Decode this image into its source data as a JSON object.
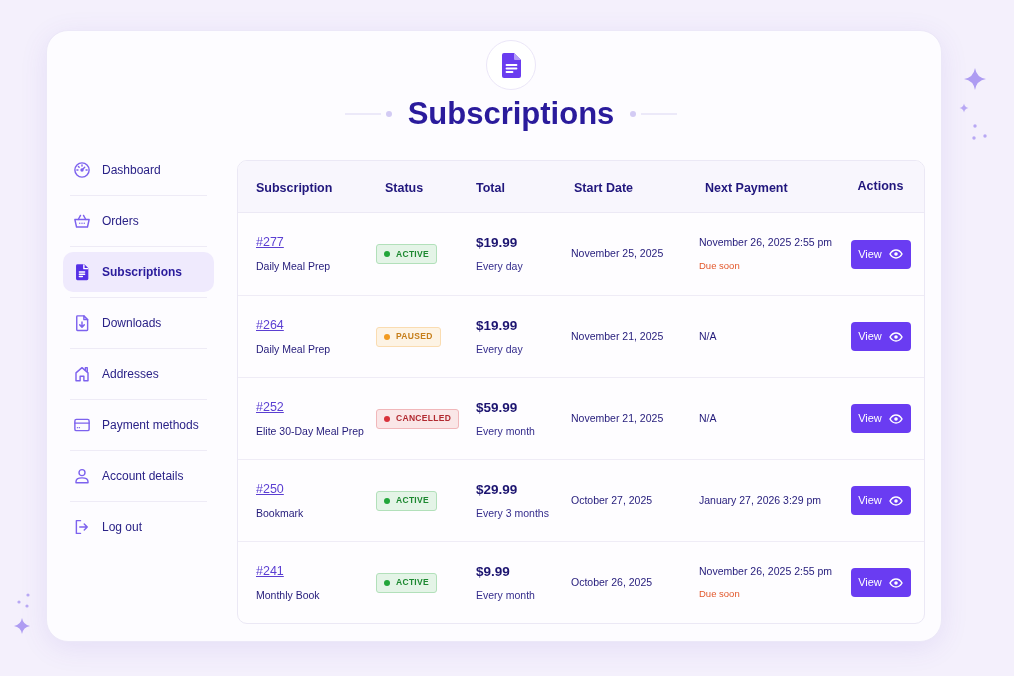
{
  "header": {
    "title": "Subscriptions"
  },
  "sidebar": {
    "items": [
      {
        "label": "Dashboard",
        "selected": false
      },
      {
        "label": "Orders",
        "selected": false
      },
      {
        "label": "Subscriptions",
        "selected": true
      },
      {
        "label": "Downloads",
        "selected": false
      },
      {
        "label": "Addresses",
        "selected": false
      },
      {
        "label": "Payment methods",
        "selected": false
      },
      {
        "label": "Account details",
        "selected": false
      },
      {
        "label": "Log out",
        "selected": false
      }
    ]
  },
  "table": {
    "columns": [
      "Subscription",
      "Status",
      "Total",
      "Start Date",
      "Next Payment",
      "Actions"
    ],
    "rows": [
      {
        "number": "#277",
        "product": "Daily Meal Prep",
        "status": {
          "label": "ACTIVE",
          "color": "#22a63a"
        },
        "total": "$19.99",
        "interval": "Every day",
        "start_date": "November 25, 2025",
        "next_payment": "November 26, 2025 2:55 pm",
        "note": "Due soon",
        "action": "View"
      },
      {
        "number": "#264",
        "product": "Daily Meal Prep",
        "status": {
          "label": "PAUSED",
          "color": "#f29a1f"
        },
        "total": "$19.99",
        "interval": "Every day",
        "start_date": "November 21, 2025",
        "next_payment": "N/A",
        "action": "View"
      },
      {
        "number": "#252",
        "product": "Elite 30-Day Meal Prep",
        "status": {
          "label": "CANCELLED",
          "color": "#d8323b"
        },
        "total": "$59.99",
        "interval": "Every month",
        "start_date": "November 21, 2025",
        "next_payment": "N/A",
        "action": "View"
      },
      {
        "number": "#250",
        "product": "Bookmark",
        "status": {
          "label": "ACTIVE",
          "color": "#22a63a"
        },
        "total": "$29.99",
        "interval": "Every 3 months",
        "start_date": "October 27, 2025",
        "next_payment": "January 27, 2026 3:29 pm",
        "action": "View"
      },
      {
        "number": "#241",
        "product": "Monthly Book",
        "status": {
          "label": "ACTIVE",
          "color": "#22a63a"
        },
        "total": "$9.99",
        "interval": "Every month",
        "start_date": "October 26, 2025",
        "next_payment": "November 26, 2025 2:55 pm",
        "note": "Due soon",
        "action": "View"
      }
    ]
  }
}
